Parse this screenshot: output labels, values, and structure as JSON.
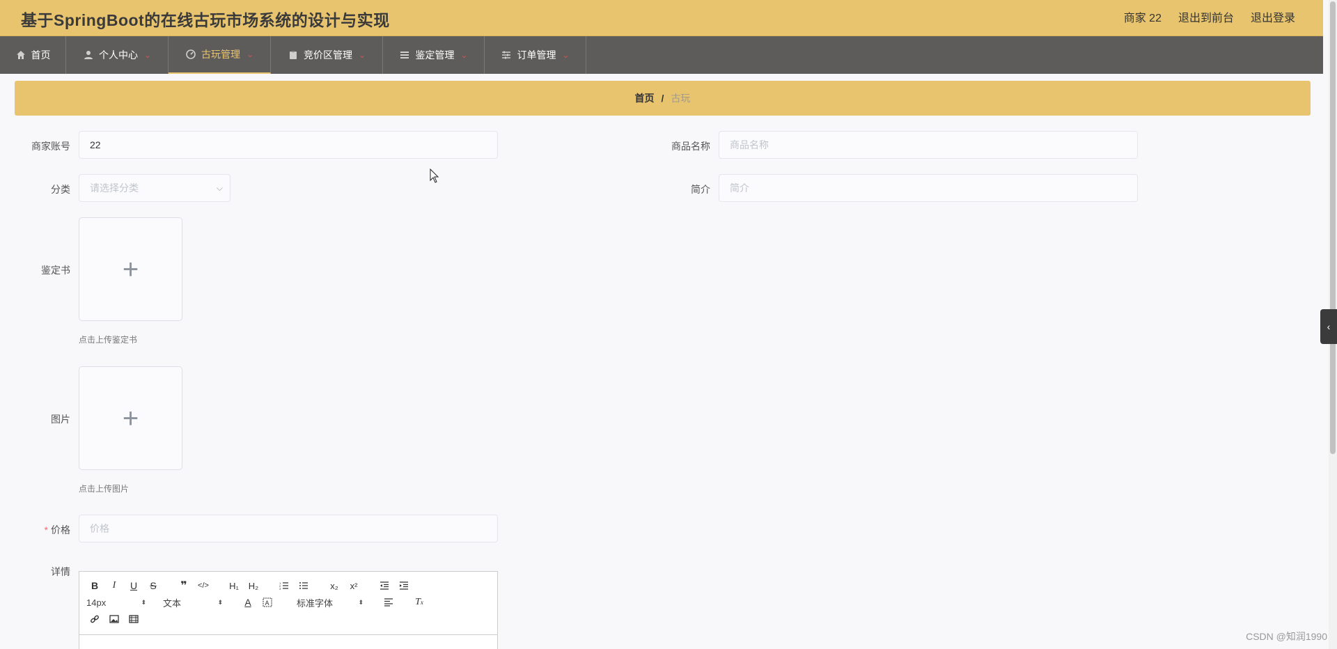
{
  "header": {
    "title": "基于SpringBoot的在线古玩市场系统的设计与实现",
    "user": "商家 22",
    "to_front": "退出到前台",
    "logout": "退出登录"
  },
  "nav": [
    {
      "label": "首页",
      "icon": "home-icon",
      "dropdown": false,
      "active": false
    },
    {
      "label": "个人中心",
      "icon": "user-icon",
      "dropdown": true,
      "active": false
    },
    {
      "label": "古玩管理",
      "icon": "dashboard-icon",
      "dropdown": true,
      "active": true
    },
    {
      "label": "竞价区管理",
      "icon": "clipboard-icon",
      "dropdown": true,
      "active": false
    },
    {
      "label": "鉴定管理",
      "icon": "list-icon",
      "dropdown": true,
      "active": false
    },
    {
      "label": "订单管理",
      "icon": "sliders-icon",
      "dropdown": true,
      "active": false
    }
  ],
  "breadcrumb": {
    "home": "首页",
    "sep": "/",
    "current": "古玩"
  },
  "form": {
    "merchant_label": "商家账号",
    "merchant_value": "22",
    "name_label": "商品名称",
    "name_placeholder": "商品名称",
    "category_label": "分类",
    "category_placeholder": "请选择分类",
    "intro_label": "简介",
    "intro_placeholder": "简介",
    "cert_label": "鉴定书",
    "cert_hint": "点击上传鉴定书",
    "image_label": "图片",
    "image_hint": "点击上传图片",
    "price_label": "价格",
    "price_placeholder": "价格",
    "detail_label": "详情"
  },
  "editor": {
    "font_size": "14px",
    "text_type": "文本",
    "font_family": "标准字体"
  },
  "watermark": "CSDN @知润1990",
  "colors": {
    "accent": "#e8c46f",
    "nav_bg": "#5e5c5b"
  }
}
